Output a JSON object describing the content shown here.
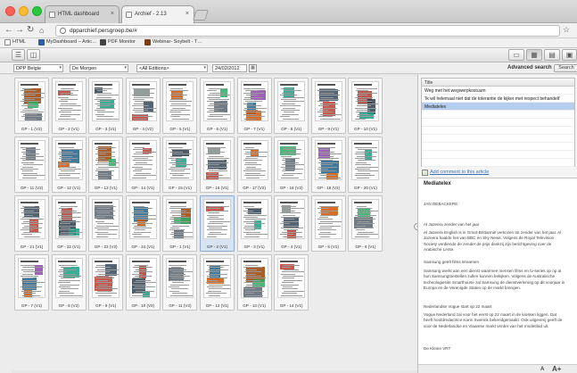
{
  "browser": {
    "tabs": [
      {
        "label": "HTML dashboard",
        "active": false
      },
      {
        "label": "Archief - 2.13",
        "active": true
      }
    ],
    "url": "dpparchief.persgroep.be/#",
    "bookmarks": [
      "HTML",
      "MyDashboard – Artic…",
      "PDF Monitor",
      "Webinar- Soybelt - T…"
    ]
  },
  "filters": {
    "edition": "DPP Belgie",
    "title": "De Morgen",
    "editions": "<All Editions>",
    "date": "24/02/2012",
    "advanced_search": "Advanced search",
    "search_button": "Search"
  },
  "pages": [
    "GP - 1 (V2)",
    "GP - 2 (V1)",
    "GP - 3 (V1)",
    "GP - 4 (V2)",
    "GP - 5 (V1)",
    "GP - 6 (V1)",
    "GP - 7 (V1)",
    "GP - 8 (V1)",
    "GP - 9 (V1)",
    "GP - 10 (V1)",
    "GP - 11 (V2)",
    "GP - 12 (V1)",
    "GP - 13 (V1)",
    "GP - 14 (V1)",
    "GP - 15 (V1)",
    "GP - 16 (V1)",
    "GP - 17 (V2)",
    "GP - 18 (V2)",
    "GP - 19 (V2)",
    "GP - 20 (V1)",
    "GP - 21 (V1)",
    "GP - 22 (V1)",
    "GP - 23 (V2)",
    "GP - 24 (V1)",
    "GP - 1 (V1)",
    "GP - 2 (V1)",
    "GP - 3 (V1)",
    "GP - 4 (V1)",
    "GP - 5 (V1)",
    "GP - 6 (V1)",
    "GP - 7 (V1)",
    "GP - 8 (V2)",
    "GP - 9 (V1)",
    "GP - 10 (V2)",
    "GP - 11 (V2)",
    "GP - 12 (V1)",
    "GP - 13 (V1)",
    "GP - 14 (V1)"
  ],
  "selected_page_index": 25,
  "articles": {
    "header": "Title",
    "rows": [
      "Weg met het wegwerpkostuum",
      "'Ik wil helemaal niet dat de tolerantie de kijker met respect behandelt'",
      "Mediatelex"
    ],
    "selected_row": 2,
    "add_comment": "Add comment to this article"
  },
  "article": {
    "title": "Mediatelex",
    "author": "JAN DEBACKERE",
    "paragraphs": [
      "Al Jazeera zender van het jaar",
      "Al Jazeera English is in Groot-Brittannië verkozen tot zender van het jaar. Al Jazeera haalde het van BBC en Sky News. Volgens de Royal Television Society verdiende de zender de prijs dankzij zijn berichtgeving over de Arabische Lente.",
      "Samsung geeft films streamen",
      "Samsung werkt aan een dienst waarmee mensen films en tv-series op op al hun Samsungtoestellen zullen kunnen bekijken. Volgens de Australische technologiesite Smarthouse zal Samsung de dienstverlening op dit voorjaar in Europa en de Verenigde Staten op de markt brengen.",
      "Nederlandse Vogue start op 22 maart",
      "Vogue Nederland zal voor het eerst op 22 maart in de kiosken liggen. Dat heeft hoofdredactrice Karin Swerink bekendgemaakt. Ook uitgeverij geeft de voor de Nederlandse en Vlaamse markt verder van het modeblad uit.",
      "De Kleine VRT"
    ],
    "font_small": "A",
    "font_large": "A+"
  }
}
